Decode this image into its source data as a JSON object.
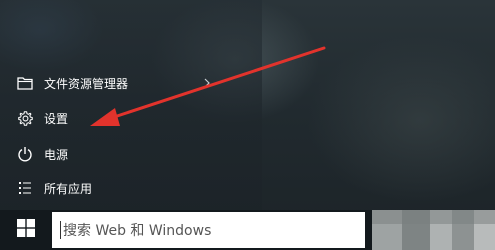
{
  "start_menu": {
    "items": [
      {
        "label": "文件资源管理器",
        "icon": "folder-icon",
        "has_submenu": true
      },
      {
        "label": "设置",
        "icon": "gear-icon",
        "has_submenu": false
      },
      {
        "label": "电源",
        "icon": "power-icon",
        "has_submenu": false
      },
      {
        "label": "所有应用",
        "icon": "list-icon",
        "has_submenu": false
      }
    ]
  },
  "taskbar": {
    "start_icon": "windows-logo-icon",
    "search_placeholder": "搜索 Web 和 Windows"
  },
  "annotation": {
    "arrow_color": "#e2332c",
    "points_to": "设置"
  }
}
